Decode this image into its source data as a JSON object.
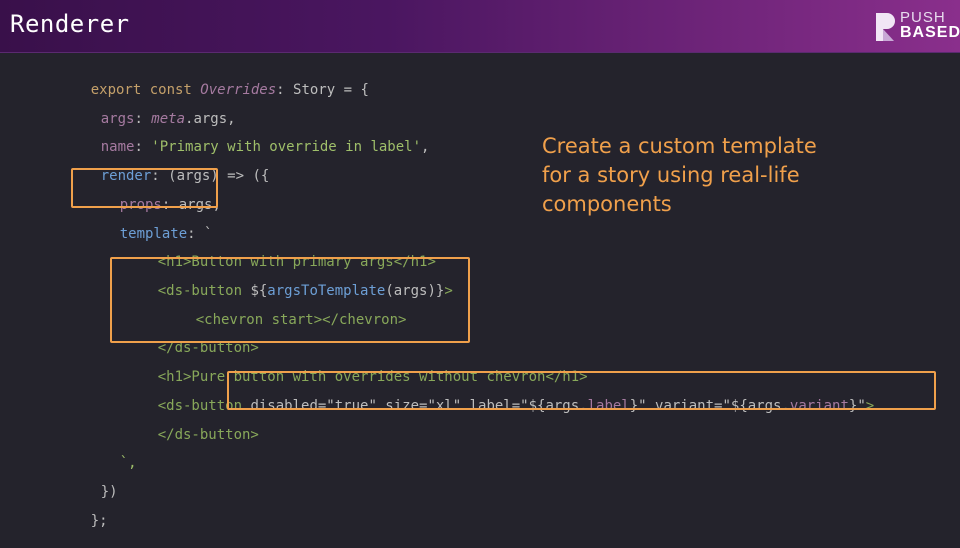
{
  "header": {
    "title": "Renderer",
    "logo_top": "PUSH",
    "logo_bottom": "BASED"
  },
  "annotation": {
    "line1": "Create a custom template",
    "line2": "for a story using real-life",
    "line3": "components"
  },
  "code": {
    "l1": {
      "a": "export const ",
      "b": "Overrides",
      "c": ": Story = {"
    },
    "l2": {
      "a": "args",
      "b": ": ",
      "c": "meta",
      "d": ".args,"
    },
    "l3": {
      "a": "name",
      "b": ": ",
      "c": "'Primary with override in label'",
      "d": ","
    },
    "l4": {
      "a": "render",
      "b": ": (args) => ({"
    },
    "l5": {
      "a": "props",
      "b": ": args,"
    },
    "l6": {
      "a": "template",
      "b": ": `"
    },
    "l7": {
      "a": "<h1>Button with primary args</h1>"
    },
    "l8": {
      "a": "<ds-button ",
      "b": "${",
      "c": "argsToTemplate",
      "d": "(args)}",
      "e": ">"
    },
    "l9": {
      "a": "<chevron start></chevron>"
    },
    "l10": {
      "a": "</ds-button>"
    },
    "l11": {
      "a": "<h1>Pure button with overrides without chevron</h1>"
    },
    "l12": {
      "a": "<ds-button ",
      "b": "disabled=\"true\" size=\"xl\" label=\"${args.",
      "c": "label",
      "d": "}\" variant=\"${args.",
      "e": "variant",
      "f": "}\"",
      "g": ">"
    },
    "l13": {
      "a": "</ds-button>"
    },
    "l14": {
      "a": "`,"
    },
    "l15": {
      "a": "})"
    },
    "l16": {
      "a": "};"
    }
  },
  "colors": {
    "accent": "#f0a04b",
    "background": "#24232c",
    "header_start": "#39104a",
    "header_end": "#8a2f8c"
  }
}
